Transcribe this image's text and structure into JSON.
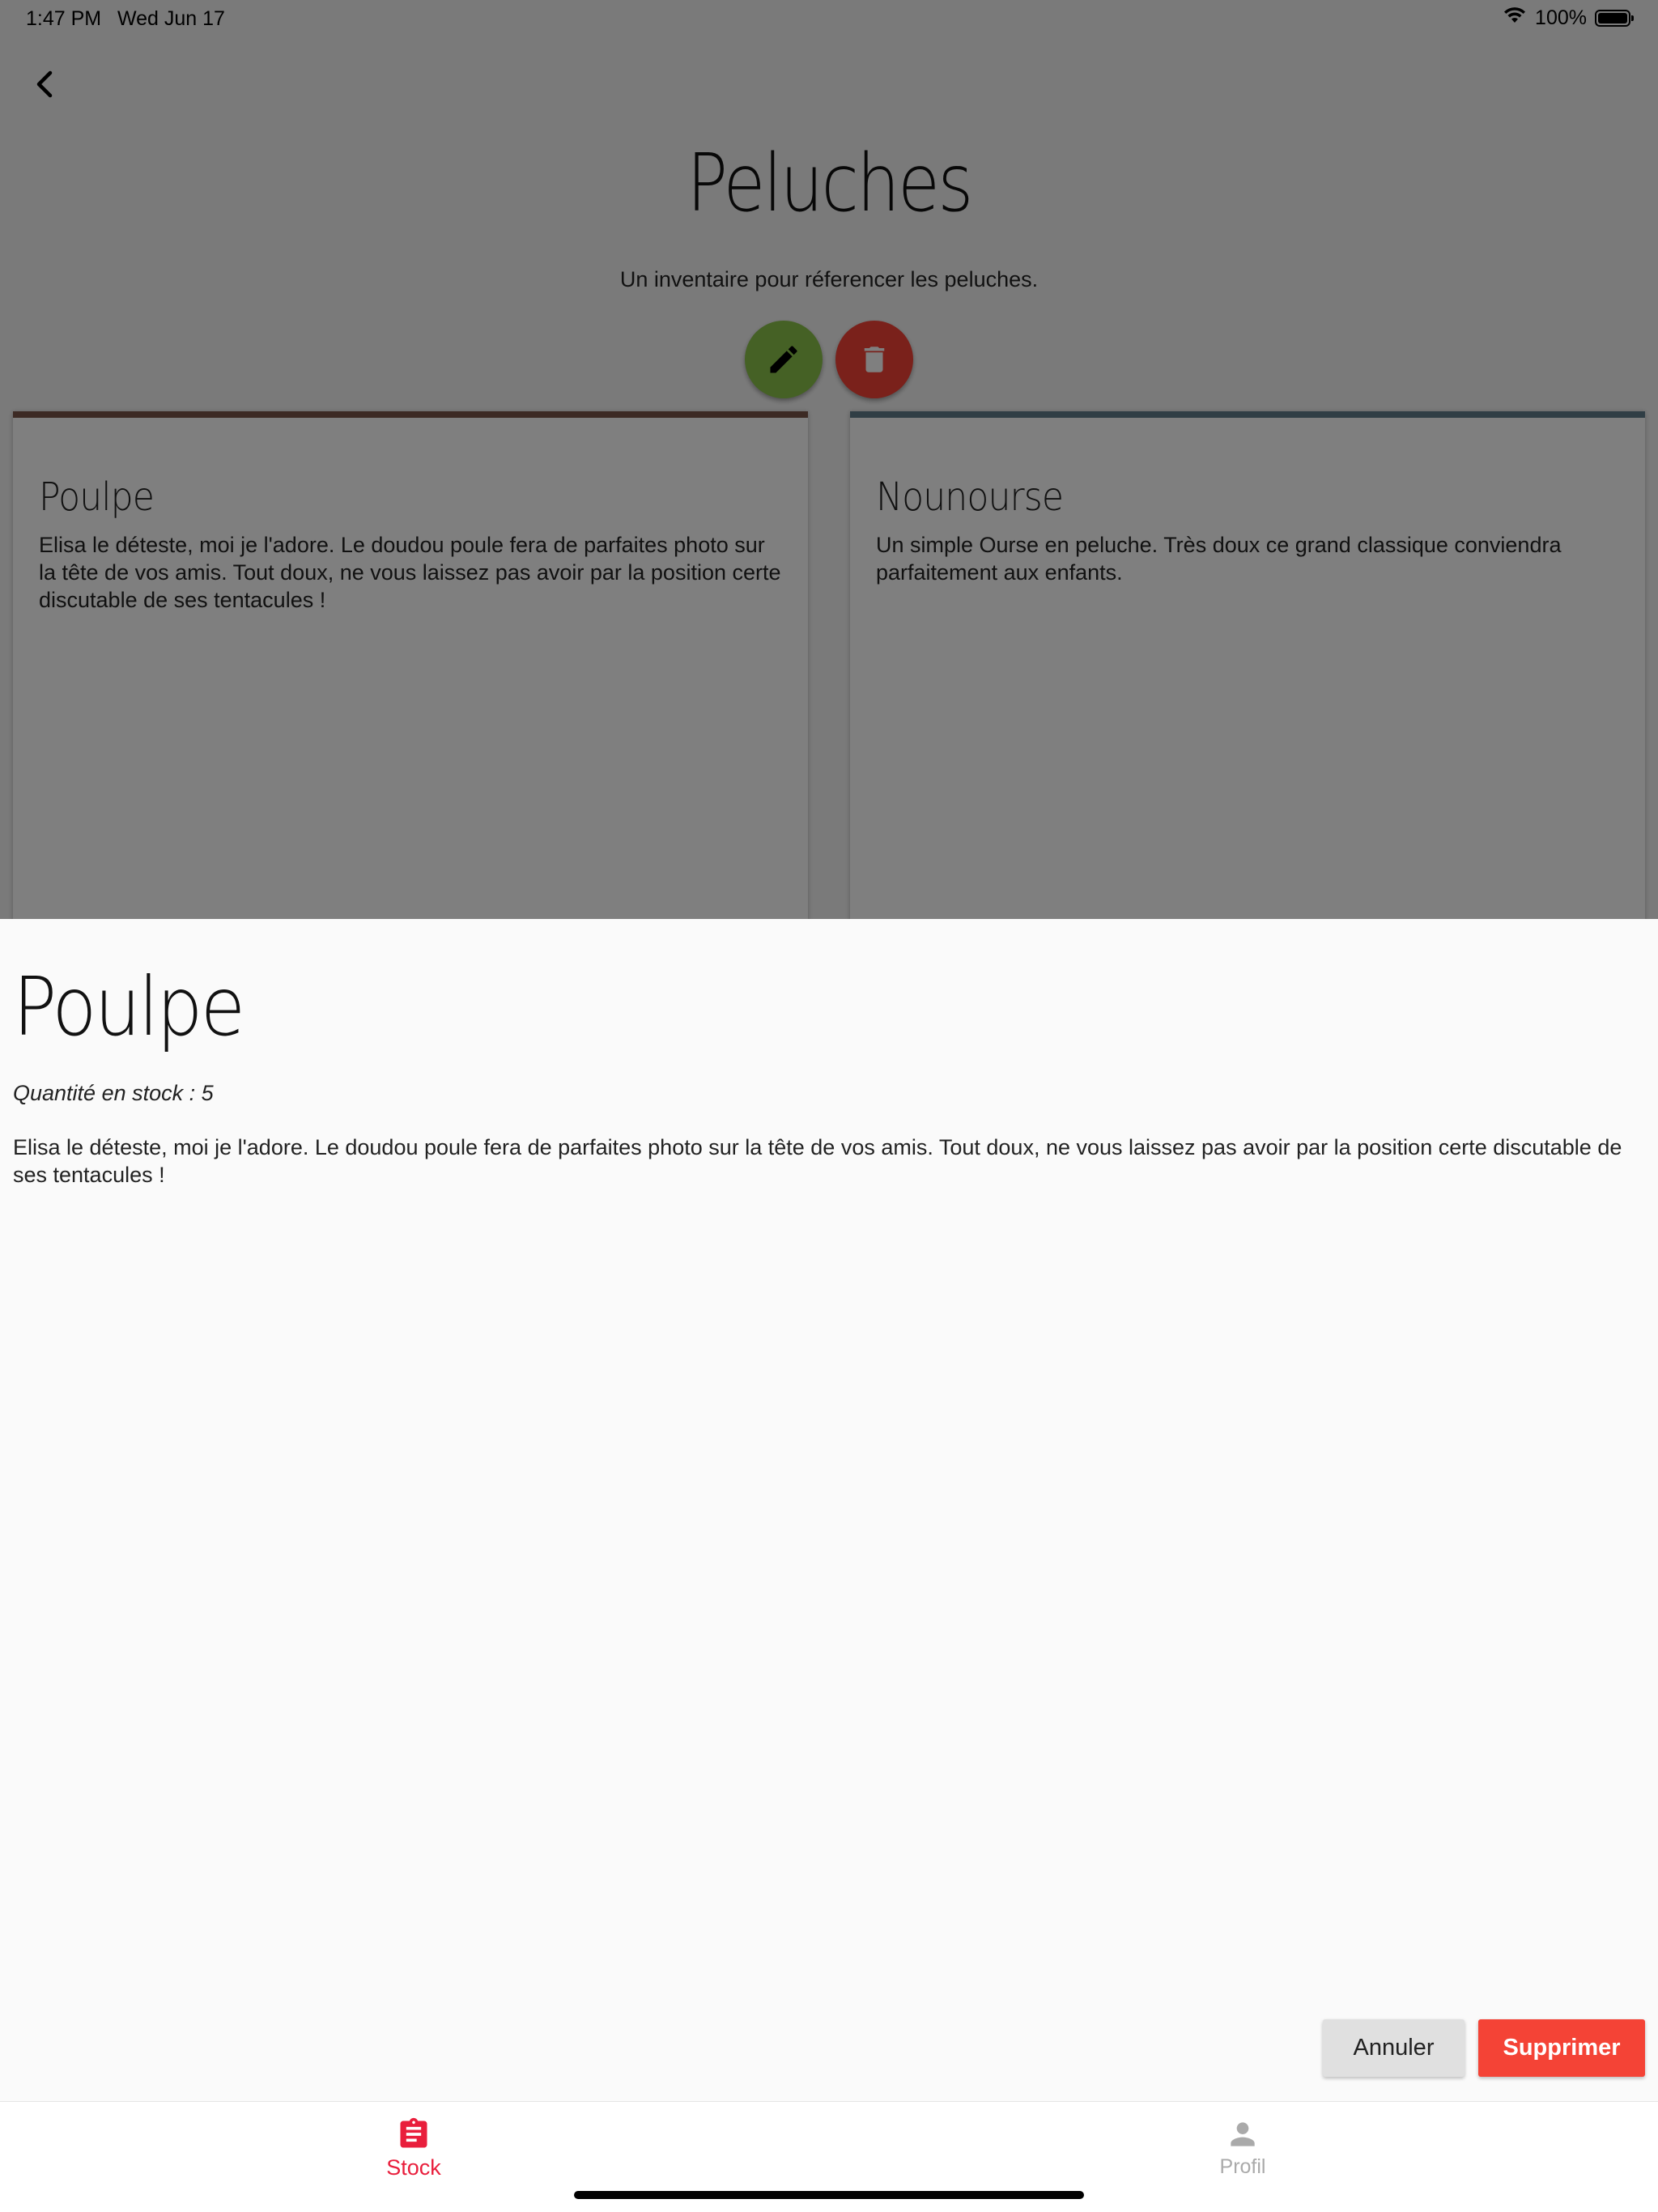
{
  "status_bar": {
    "time": "1:47 PM",
    "date": "Wed Jun 17",
    "battery": "100%"
  },
  "page": {
    "title": "Peluches",
    "subtitle": "Un inventaire pour réferencer les peluches."
  },
  "cards": [
    {
      "title": "Poulpe",
      "description": "Elisa le déteste, moi je l'adore. Le doudou poule fera de parfaites photo sur la tête de vos amis. Tout doux, ne vous laissez pas avoir par la position certe discutable de ses tentacules !",
      "accent_color": "#795548"
    },
    {
      "title": "Nounourse",
      "description": "Un simple Ourse en peluche. Très doux ce grand classique conviendra parfaitement aux enfants.",
      "accent_color": "#607d8b"
    }
  ],
  "sheet": {
    "title": "Poulpe",
    "quantity": "Quantité en stock : 5",
    "description": "Elisa le déteste, moi je l'adore. Le doudou poule fera de parfaites photo sur la tête de vos amis. Tout doux, ne vous laissez pas avoir par la position certe discutable de ses tentacules !",
    "cancel_label": "Annuler",
    "delete_label": "Supprimer"
  },
  "tabbar": {
    "stock_label": "Stock",
    "profil_label": "Profil",
    "active_color": "#e91e3c",
    "inactive_color": "#aaaaaa"
  },
  "icons": {
    "back": "chevron-left-icon",
    "edit": "pencil-icon",
    "delete": "trash-icon",
    "stock": "clipboard-icon",
    "profil": "person-icon",
    "wifi": "wifi-icon",
    "battery": "battery-icon"
  },
  "colors": {
    "edit_fab": "#8bc34a",
    "delete_fab": "#f44336",
    "delete_button": "#f44336",
    "cancel_button": "#e0e0e0"
  }
}
